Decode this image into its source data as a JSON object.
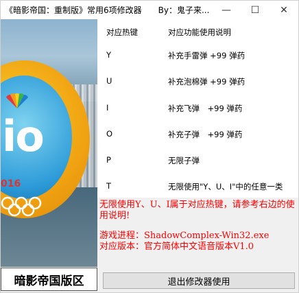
{
  "window": {
    "title": "《暗影帝国：重制版》常用6项修改器　　By：鬼子来...",
    "minimize_glyph": "—",
    "maximize_glyph": "☐",
    "close_glyph": "✕"
  },
  "table": {
    "header": {
      "key": "对应热键",
      "desc": "对应功能使用说明"
    },
    "rows": [
      {
        "key": "Y",
        "desc": "补充手雷弹 +99 弹药"
      },
      {
        "key": "U",
        "desc": "补充泡棉弹 +99 弹药"
      },
      {
        "key": "I",
        "desc": "补充飞弹　+99 弹药"
      },
      {
        "key": "O",
        "desc": "补充子弹　+99 弹药"
      },
      {
        "key": "P",
        "desc": "无限子弹"
      },
      {
        "key": "T",
        "desc": "无限使用\"Y、U、I\"中的任意一类"
      }
    ]
  },
  "notes": {
    "hotkey_note": "无限使用Y、U、I属于对应热键，请参考右边的使用说明!",
    "process_line": "游戏进程：ShadowComplex-Win32.exe",
    "version_line": "对应版本：官方简体中文语音版本V1.0"
  },
  "banner": {
    "logo_text": "io",
    "year_text": "016",
    "caption": "暗影帝国版区"
  },
  "buttons": {
    "exit_label": "退出修改器使用"
  }
}
